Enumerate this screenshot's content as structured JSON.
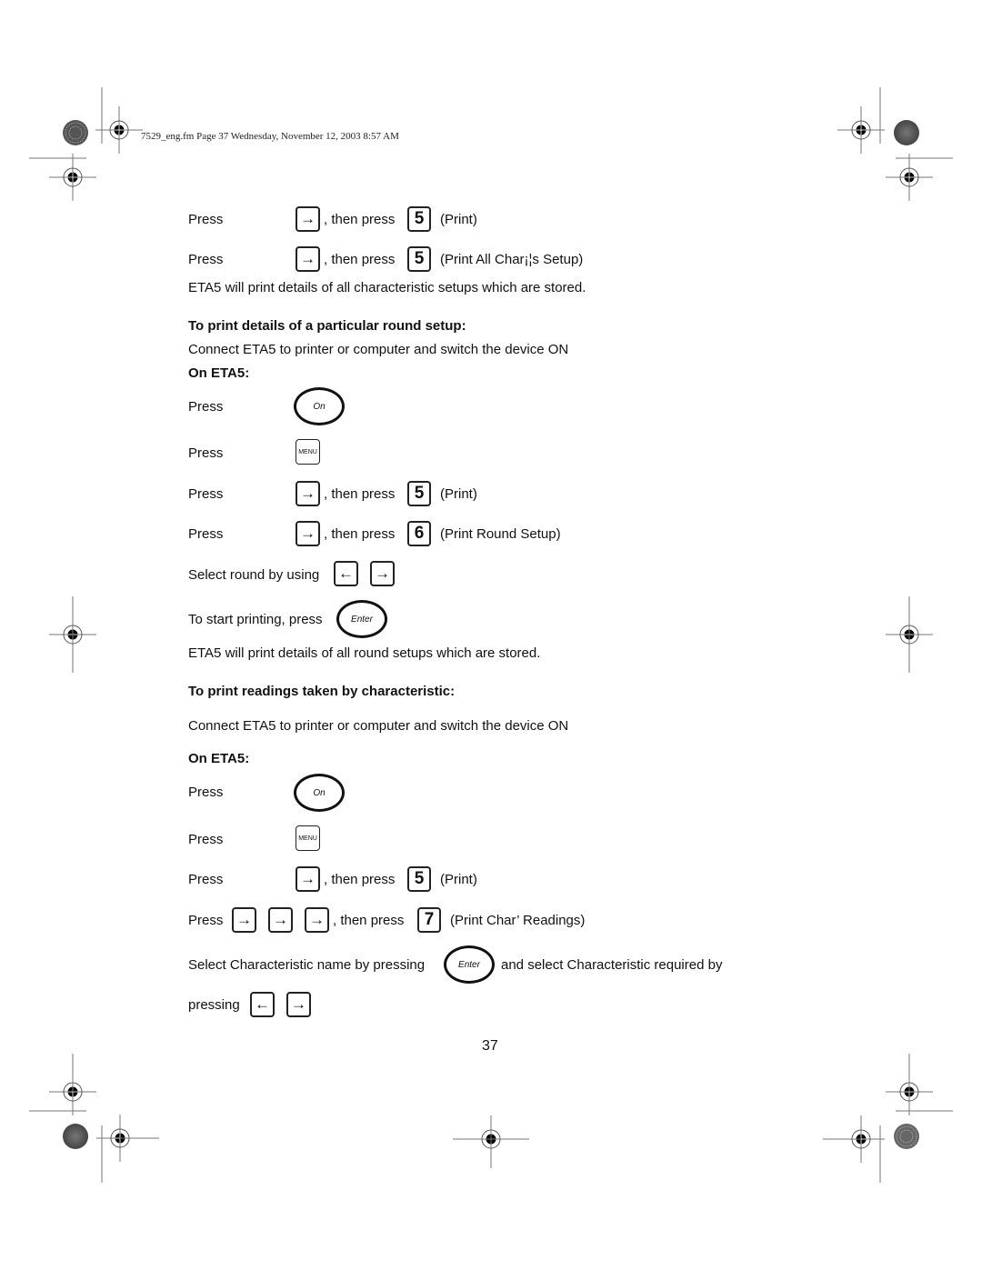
{
  "header": {
    "text": "7529_eng.fm  Page 37  Wednesday, November 12, 2003  8:57 AM"
  },
  "keys": {
    "right_arrow": "→",
    "left_arrow": "←",
    "menu": "MENU",
    "on": "On",
    "enter": "Enter",
    "five": "5",
    "six": "6",
    "seven": "7"
  },
  "section_top": {
    "rows": [
      {
        "press": "Press",
        "then": ", then press",
        "desc": "(Print)"
      },
      {
        "press": "Press",
        "then": ", then press",
        "desc": "(Print All Char¡¦s Setup)"
      }
    ],
    "note": "ETA5 will print details of all characteristic setups which are stored."
  },
  "section_round": {
    "heading": "To print details of a particular round setup:",
    "connect": "Connect ETA5 to printer or computer and switch the device ON",
    "on_eta5": "On ETA5:",
    "press_on": "Press",
    "press_menu": "Press",
    "rows": [
      {
        "press": "Press",
        "then": ", then press",
        "desc": "(Print)"
      },
      {
        "press": "Press",
        "then": ", then press",
        "desc": "(Print Round Setup)"
      }
    ],
    "select": "Select round by using",
    "start": "To start printing, press",
    "note": "ETA5 will print details of all round setups which are stored."
  },
  "section_char": {
    "heading": "To print readings taken by characteristic:",
    "connect": "Connect ETA5 to printer or computer and switch the device ON",
    "on_eta5": "On ETA5:",
    "press_on": "Press",
    "press_menu": "Press",
    "rows": [
      {
        "press": "Press",
        "then": ", then press",
        "desc": "(Print)"
      },
      {
        "press": "Press",
        "then": ", then press",
        "desc": "(Print Char’ Readings)"
      }
    ],
    "select_a": "Select Characteristic name by pressing",
    "select_b": "and select Characteristic required by",
    "pressing": "pressing"
  },
  "page_number": "37"
}
